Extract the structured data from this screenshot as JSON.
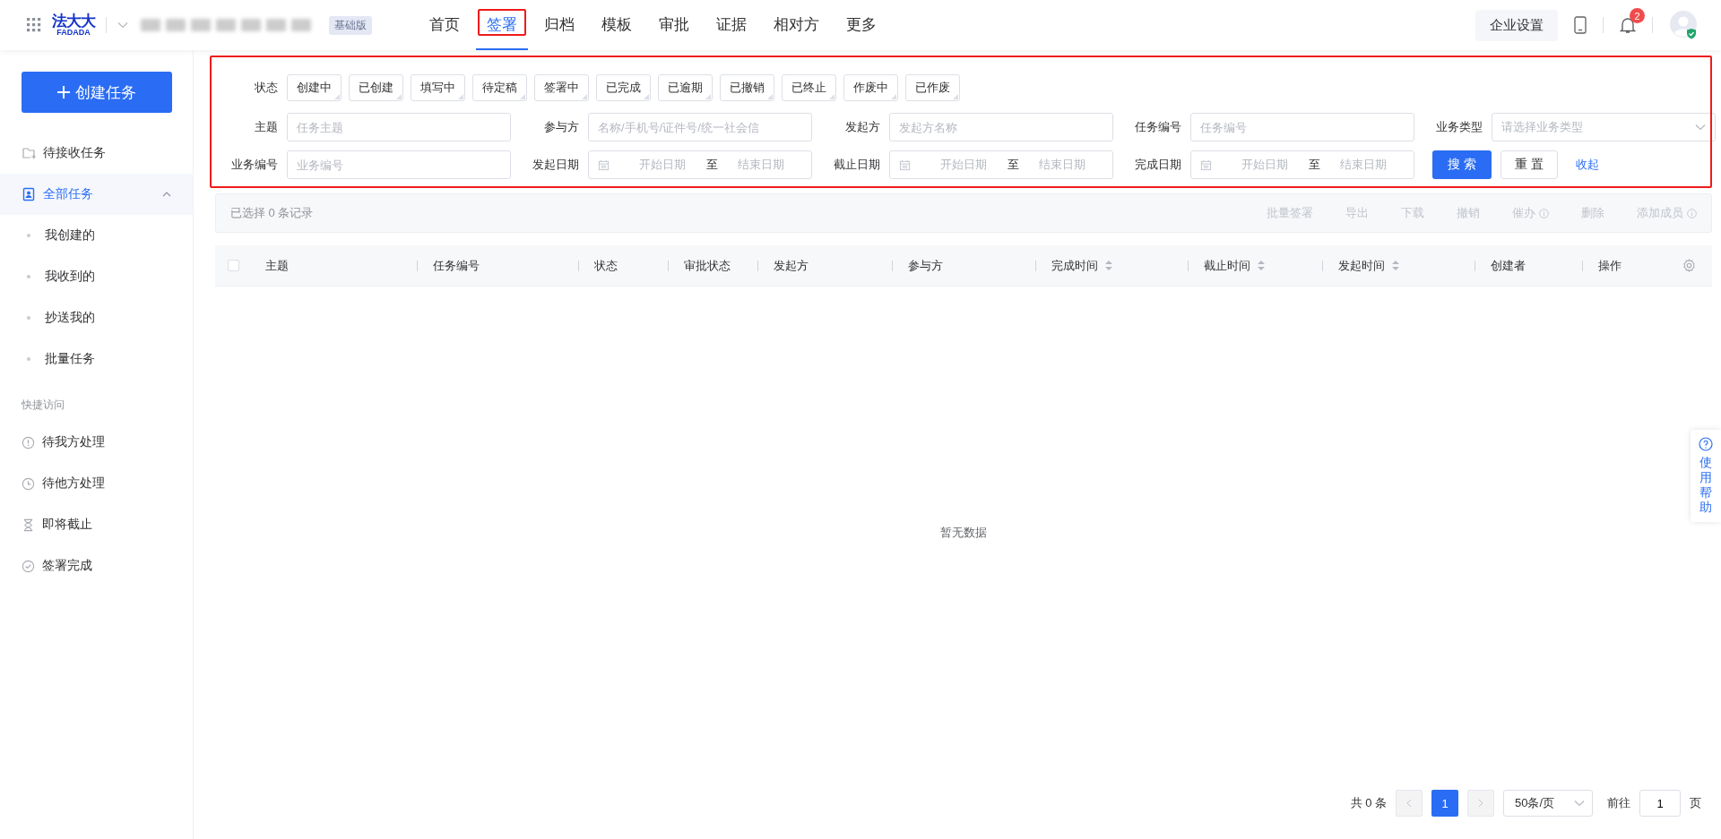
{
  "header": {
    "logo": {
      "top": "法大大",
      "bottom": "FADADA"
    },
    "edition_badge": "基础版",
    "nav": [
      {
        "label": "首页",
        "selected": false,
        "highlighted": false
      },
      {
        "label": "签署",
        "selected": true,
        "highlighted": true
      },
      {
        "label": "归档",
        "selected": false,
        "highlighted": false
      },
      {
        "label": "模板",
        "selected": false,
        "highlighted": false
      },
      {
        "label": "审批",
        "selected": false,
        "highlighted": false
      },
      {
        "label": "证据",
        "selected": false,
        "highlighted": false
      },
      {
        "label": "相对方",
        "selected": false,
        "highlighted": false
      },
      {
        "label": "更多",
        "selected": false,
        "highlighted": false
      }
    ],
    "settings_button": "企业设置",
    "notification_count": "2"
  },
  "sidebar": {
    "create_button": "创建任务",
    "items": [
      {
        "label": "待接收任务",
        "selected": false
      },
      {
        "label": "全部任务",
        "selected": true,
        "expanded": true,
        "children": [
          {
            "label": "我创建的",
            "selected": false
          },
          {
            "label": "我收到的",
            "selected": false
          },
          {
            "label": "抄送我的",
            "selected": false
          },
          {
            "label": "批量任务",
            "selected": false
          }
        ]
      }
    ],
    "section_title": "快捷访问",
    "quick_links": [
      {
        "label": "待我方处理"
      },
      {
        "label": "待他方处理"
      },
      {
        "label": "即将截止"
      },
      {
        "label": "签署完成"
      }
    ]
  },
  "filters": {
    "highlighted": true,
    "status_label": "状态",
    "status_chips": [
      {
        "label": "创建中",
        "selected": false
      },
      {
        "label": "已创建",
        "selected": false
      },
      {
        "label": "填写中",
        "selected": false
      },
      {
        "label": "待定稿",
        "selected": false
      },
      {
        "label": "签署中",
        "selected": false
      },
      {
        "label": "已完成",
        "selected": false
      },
      {
        "label": "已逾期",
        "selected": false
      },
      {
        "label": "已撤销",
        "selected": false
      },
      {
        "label": "已终止",
        "selected": false
      },
      {
        "label": "作废中",
        "selected": false
      },
      {
        "label": "已作废",
        "selected": false
      }
    ],
    "fields": [
      {
        "kind": "text",
        "label": "主题",
        "placeholder": "任务主题"
      },
      {
        "kind": "text",
        "label": "参与方",
        "placeholder": "名称/手机号/证件号/统一社会信"
      },
      {
        "kind": "text",
        "label": "发起方",
        "placeholder": "发起方名称"
      },
      {
        "kind": "text",
        "label": "任务编号",
        "placeholder": "任务编号"
      },
      {
        "kind": "select",
        "label": "业务类型",
        "placeholder": "请选择业务类型"
      },
      {
        "kind": "text",
        "label": "业务编号",
        "placeholder": "业务编号"
      },
      {
        "kind": "daterange",
        "label": "发起日期",
        "start": "开始日期",
        "separator": "至",
        "end": "结束日期"
      },
      {
        "kind": "daterange",
        "label": "截止日期",
        "start": "开始日期",
        "separator": "至",
        "end": "结束日期"
      },
      {
        "kind": "daterange",
        "label": "完成日期",
        "start": "开始日期",
        "separator": "至",
        "end": "结束日期"
      }
    ],
    "search_button": "搜 索",
    "reset_button": "重 置",
    "collapse_link": "收起"
  },
  "toolbar": {
    "selection": "已选择 0 条记录",
    "actions": [
      {
        "label": "批量签署",
        "disabled": true,
        "hint": false
      },
      {
        "label": "导出",
        "disabled": true,
        "hint": false
      },
      {
        "label": "下载",
        "disabled": true,
        "hint": false
      },
      {
        "label": "撤销",
        "disabled": true,
        "hint": false
      },
      {
        "label": "催办",
        "disabled": true,
        "hint": true
      },
      {
        "label": "删除",
        "disabled": true,
        "hint": false
      },
      {
        "label": "添加成员",
        "disabled": true,
        "hint": true
      }
    ]
  },
  "table": {
    "select_all_checked": false,
    "columns": [
      {
        "label": "主题",
        "sortable": false
      },
      {
        "label": "任务编号",
        "sortable": false
      },
      {
        "label": "状态",
        "sortable": false
      },
      {
        "label": "审批状态",
        "sortable": false
      },
      {
        "label": "发起方",
        "sortable": false
      },
      {
        "label": "参与方",
        "sortable": false
      },
      {
        "label": "完成时间",
        "sortable": true
      },
      {
        "label": "截止时间",
        "sortable": true
      },
      {
        "label": "发起时间",
        "sortable": true
      },
      {
        "label": "创建者",
        "sortable": false
      },
      {
        "label": "操作",
        "sortable": false
      }
    ],
    "empty_text": "暂无数据"
  },
  "pagination": {
    "total": "共 0 条",
    "pages": [
      {
        "label": "1",
        "selected": true
      }
    ],
    "page_size": "50条/页",
    "goto_label": "前往",
    "goto_value": "1",
    "goto_suffix": "页"
  },
  "help_tab": "使用帮助"
}
